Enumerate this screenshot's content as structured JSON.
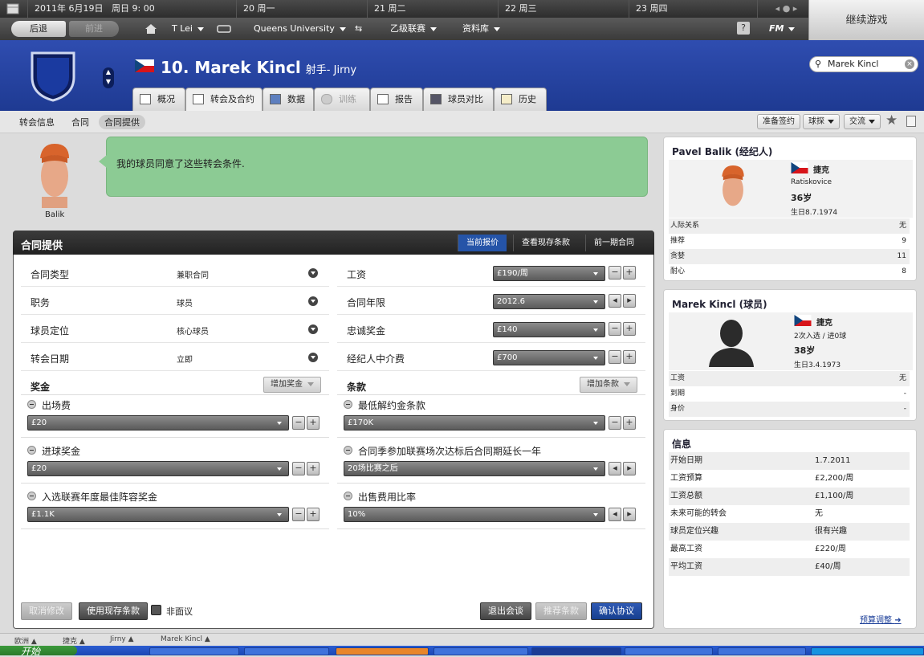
{
  "datebar": {
    "date": "2011年 6月19日",
    "day_time": "周日 9: 00",
    "days": [
      "20 周一",
      "21 周二",
      "22 周三",
      "23 周四"
    ]
  },
  "continue_label": "继续游戏",
  "nav": {
    "back": "后退",
    "forward": "前进",
    "manager": "T Lei",
    "club": "Queens University",
    "league": "乙级联赛",
    "database": "资料库",
    "help": "?",
    "fm_menu": "FM"
  },
  "player": {
    "number_name": "10. Marek Kincl",
    "position_club": "射手- Jirny"
  },
  "search": {
    "value": "Marek Kincl"
  },
  "tabs": [
    "概况",
    "转会及合约",
    "数据",
    "训练",
    "报告",
    "球员对比",
    "历史"
  ],
  "subtabs": [
    "转会信息",
    "合同",
    "合同提供"
  ],
  "right_buttons": [
    "准备签约",
    "球探",
    "交流"
  ],
  "message": {
    "portrait_name": "Balik",
    "text": "我的球员同意了这些转会条件."
  },
  "panel": {
    "title": "合同提供",
    "header_buttons": [
      "当前报价",
      "查看现存条款",
      "前一期合同"
    ],
    "left_fields": [
      {
        "label": "合同类型",
        "value": "兼职合同"
      },
      {
        "label": "职务",
        "value": "球员"
      },
      {
        "label": "球员定位",
        "value": "核心球员"
      },
      {
        "label": "转会日期",
        "value": "立即"
      }
    ],
    "right_fields": [
      {
        "label": "工资",
        "value": "£190/周"
      },
      {
        "label": "合同年限",
        "value": "2012.6"
      },
      {
        "label": "忠诚奖金",
        "value": "£140"
      },
      {
        "label": "经纪人中介费",
        "value": "£700"
      }
    ],
    "bonus_title": "奖金",
    "bonus_add": "增加奖金",
    "bonuses": [
      {
        "label": "出场费",
        "value": "£20"
      },
      {
        "label": "进球奖金",
        "value": "£20"
      },
      {
        "label": "入选联赛年度最佳阵容奖金",
        "value": "£1.1K"
      }
    ],
    "clause_title": "条款",
    "clause_add": "增加条款",
    "clauses": [
      {
        "label": "最低解约金条款",
        "value": "£170K"
      },
      {
        "label": "合同季参加联赛场次达标后合同期延长一年",
        "value": "20场比赛之后"
      },
      {
        "label": "出售费用比率",
        "value": "10%"
      }
    ],
    "bottom": {
      "cancel": "取消修改",
      "use_existing": "使用现存条款",
      "non_negotiable": "非面议",
      "leave": "退出会谈",
      "suggest": "推荐条款",
      "confirm": "确认协议"
    }
  },
  "agent_card": {
    "title": "Pavel Balik (经纪人)",
    "nation": "捷克",
    "city": "Ratiskovice",
    "age": "36岁",
    "birth": "生日8.7.1974",
    "rows": [
      {
        "k": "人际关系",
        "v": "无"
      },
      {
        "k": "推荐",
        "v": "9"
      },
      {
        "k": "贪婪",
        "v": "11"
      },
      {
        "k": "耐心",
        "v": "8"
      }
    ]
  },
  "player_card": {
    "title": "Marek Kincl (球员)",
    "nation": "捷克",
    "caps": "2次入选 / 进0球",
    "age": "38岁",
    "birth": "生日3.4.1973",
    "rows": [
      {
        "k": "工资",
        "v": "无"
      },
      {
        "k": "到期",
        "v": "-"
      },
      {
        "k": "身价",
        "v": "-"
      }
    ]
  },
  "info_card": {
    "title": "信息",
    "rows": [
      {
        "k": "开始日期",
        "v": "1.7.2011"
      },
      {
        "k": "工资预算",
        "v": "£2,200/周"
      },
      {
        "k": "工资总额",
        "v": "£1,100/周"
      },
      {
        "k": "未来可能的转会",
        "v": "无"
      },
      {
        "k": "球员定位兴趣",
        "v": "很有兴趣"
      },
      {
        "k": "最高工资",
        "v": "£220/周"
      },
      {
        "k": "平均工资",
        "v": "£40/周"
      }
    ],
    "link": "预算调整"
  },
  "statusbar": [
    "欧洲",
    "捷克",
    "Jirny",
    "Marek Kincl"
  ],
  "taskbar": {
    "start": "开始"
  },
  "colors": {
    "header_blue": "#1e3a92",
    "accent": "#2554a8",
    "bubble_green": "#8ccb94"
  }
}
